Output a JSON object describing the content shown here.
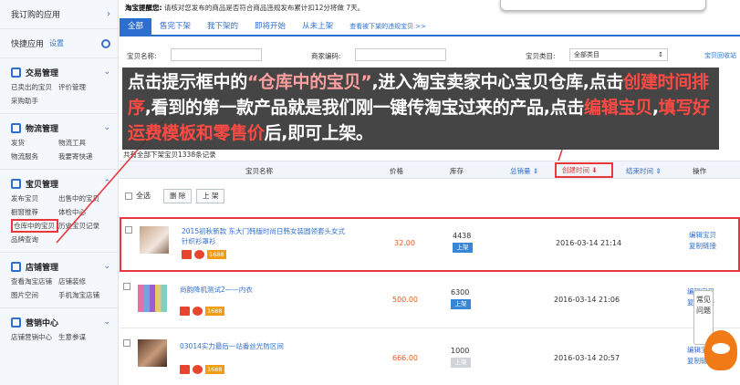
{
  "sidebar": {
    "my_apps": "我订购的应用",
    "quick_apps": "快捷应用",
    "quick_settings": "设置",
    "sections": [
      {
        "title": "交易管理",
        "rows": [
          [
            "已卖出的宝贝",
            "评价管理"
          ],
          [
            "采购助手",
            ""
          ]
        ]
      },
      {
        "title": "物流管理",
        "rows": [
          [
            "发货",
            "物流工具"
          ],
          [
            "物流服务",
            "我要寄快递"
          ]
        ]
      },
      {
        "title": "宝贝管理",
        "rows": [
          [
            "发布宝贝",
            "出售中的宝贝"
          ],
          [
            "橱窗推荐",
            "体检中心"
          ],
          [
            "仓库中的宝贝",
            "历史宝贝记录"
          ],
          [
            "品牌查询",
            ""
          ]
        ]
      },
      {
        "title": "店铺管理",
        "rows": [
          [
            "查看淘宝店铺",
            "店铺装修"
          ],
          [
            "图片空间",
            "手机淘宝店铺"
          ]
        ]
      },
      {
        "title": "营销中心",
        "rows": [
          [
            "店铺营销中心",
            "生意参谋"
          ]
        ]
      }
    ]
  },
  "notice": {
    "label": "淘宝提醒您:",
    "text": "请核对您发布的商品是否符合商品违规发布累计扣12分将做 7天。"
  },
  "tabs": [
    "全部",
    "售完下架",
    "我下架的",
    "即将开始",
    "从未上架",
    "查看被下架的违规宝贝 >>"
  ],
  "filters": {
    "name_label": "宝贝名称:",
    "code_label": "商家编码:",
    "cat_label": "宝贝类目:",
    "cat_value": "全部类目",
    "help": "宝贝回收站"
  },
  "overlay": {
    "p1": "点击提示框中的",
    "q1": "“仓库中的宝贝”",
    "p2": ",进入淘宝卖家中心宝贝仓库,点击",
    "q2": "创建时间排序",
    "p3": ",看到的第一款产品就是我们刚一键传淘宝过来的产品,点击",
    "q3": "编辑宝贝",
    "p4": ",",
    "q4": "填写好运费模板和零售价",
    "p5": "后,即可上架。"
  },
  "table": {
    "count_text": "共有全部下架宝贝1338条记录",
    "headers": {
      "name": "宝贝名称",
      "price": "价格",
      "stock": "库存",
      "sales": "总销量",
      "created": "创建时间",
      "end": "结束时间",
      "ops": "操作"
    },
    "select_all": "全选",
    "delete": "删 除",
    "publish": "上 架",
    "rows": [
      {
        "title": "2015初秋新款 东大门韩版时尚日韩女装圆领套头女式针织衫罩衫",
        "tag": "1688",
        "price": "32.00",
        "stock": "4438",
        "status": "上架",
        "created": "2016-03-14 21:14",
        "op1": "编辑宝贝",
        "op2": "复制链接"
      },
      {
        "title": "尚韵降机测试2——内衣",
        "tag": "1688",
        "price": "500.00",
        "stock": "6300",
        "status": "上架",
        "created": "2016-03-14 21:06",
        "op1": "编辑宝贝",
        "op2": "复制链接"
      },
      {
        "title": "03014实力最后一站番丝光防区间",
        "tag": "1688",
        "price": "666.00",
        "stock": "1000",
        "status": "上架",
        "created": "2016-03-14 20:57",
        "op1": "编辑宝贝",
        "op2": "复制链接"
      }
    ]
  },
  "faq": "常见问题"
}
